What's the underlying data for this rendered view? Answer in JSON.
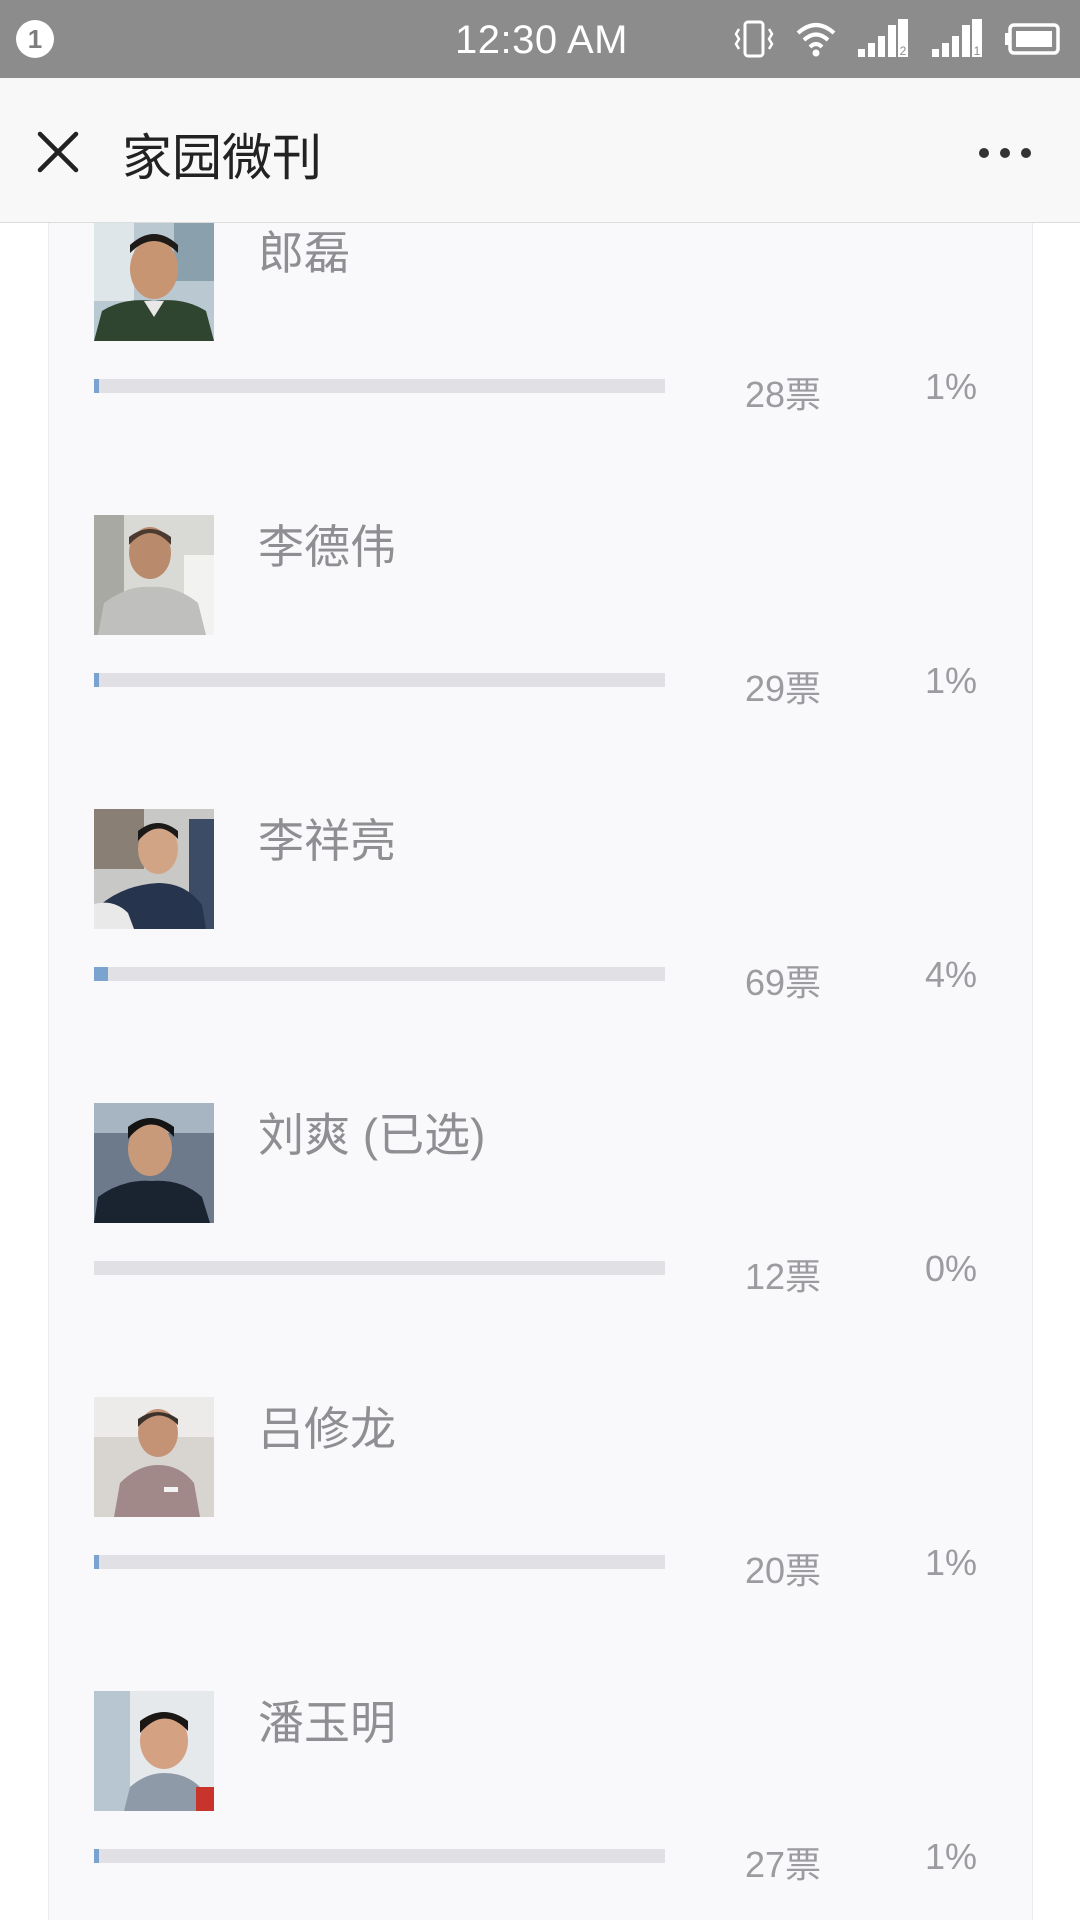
{
  "status_bar": {
    "notification_count": "1",
    "time": "12:30 AM",
    "icons": [
      "vibrate-icon",
      "wifi-icon",
      "signal-sim2-icon",
      "signal-sim1-icon",
      "battery-icon"
    ]
  },
  "header": {
    "close_icon": "close-icon",
    "title": "家园微刊",
    "more_icon": "more-icon"
  },
  "colors": {
    "status_bar_bg": "#8c8c8c",
    "bar_track": "#e0e0e5",
    "bar_fill": "#7ba3d0",
    "text_muted": "#9b9ba0"
  },
  "poll": {
    "options": [
      {
        "name": "郎磊",
        "votes": "28票",
        "percent": "1%",
        "fill_fraction": 0.01
      },
      {
        "name": "李德伟",
        "votes": "29票",
        "percent": "1%",
        "fill_fraction": 0.01
      },
      {
        "name": "李祥亮",
        "votes": "69票",
        "percent": "4%",
        "fill_fraction": 0.04
      },
      {
        "name": "刘爽 (已选)",
        "votes": "12票",
        "percent": "0%",
        "fill_fraction": 0.0
      },
      {
        "name": "吕修龙",
        "votes": "20票",
        "percent": "1%",
        "fill_fraction": 0.01
      },
      {
        "name": "潘玉明",
        "votes": "27票",
        "percent": "1%",
        "fill_fraction": 0.01
      }
    ]
  }
}
